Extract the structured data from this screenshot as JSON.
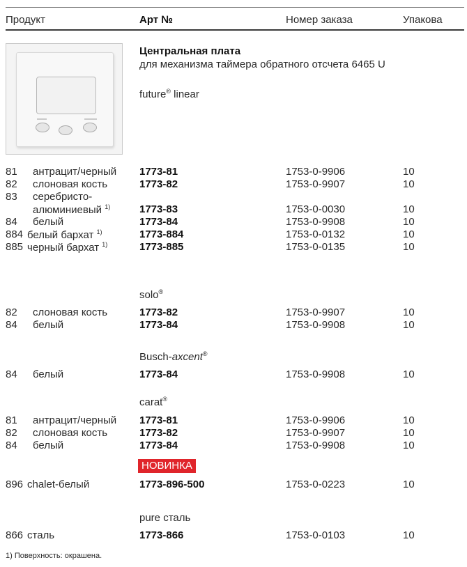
{
  "header": {
    "col_product": "Продукт",
    "col_art": "Арт №",
    "col_order": "Номер заказа",
    "col_pack": "Упакова"
  },
  "product": {
    "title": "Центральная плата",
    "subtitle": "для механизма таймера обратного отсчета 6465 U"
  },
  "sections": [
    {
      "series_name": "future",
      "series_reg": "®",
      "series_suffix": " linear",
      "rows": [
        {
          "code": "81",
          "name": "антрацит/черный",
          "art": "1773-81",
          "order": "1753-0-9906",
          "pack": "10"
        },
        {
          "code": "82",
          "name": "слоновая кость",
          "art": "1773-82",
          "order": "1753-0-9907",
          "pack": "10"
        },
        {
          "code": "83",
          "name": "серебристо-",
          "name2": "алюминиевый",
          "note": "1)",
          "art": "1773-83",
          "order": "1753-0-0030",
          "pack": "10"
        },
        {
          "code": "84",
          "name": "белый",
          "art": "1773-84",
          "order": "1753-0-9908",
          "pack": "10"
        },
        {
          "code": "884",
          "name": "белый бархат",
          "note": "1)",
          "art": "1773-884",
          "order": "1753-0-0132",
          "pack": "10"
        },
        {
          "code": "885",
          "name": "черный бархат",
          "note": "1)",
          "art": "1773-885",
          "order": "1753-0-0135",
          "pack": "10"
        }
      ]
    },
    {
      "series_name": "solo",
      "series_reg": "®",
      "rows": [
        {
          "code": "82",
          "name": "слоновая кость",
          "art": "1773-82",
          "order": "1753-0-9907",
          "pack": "10"
        },
        {
          "code": "84",
          "name": "белый",
          "art": "1773-84",
          "order": "1753-0-9908",
          "pack": "10"
        }
      ]
    },
    {
      "series_name": "Busch-",
      "series_italic": "axcent",
      "series_reg": "®",
      "rows": [
        {
          "code": "84",
          "name": "белый",
          "art": "1773-84",
          "order": "1753-0-9908",
          "pack": "10"
        }
      ]
    },
    {
      "series_name": "carat",
      "series_reg": "®",
      "rows": [
        {
          "code": "81",
          "name": "антрацит/черный",
          "art": "1773-81",
          "order": "1753-0-9906",
          "pack": "10"
        },
        {
          "code": "82",
          "name": "слоновая кость",
          "art": "1773-82",
          "order": "1753-0-9907",
          "pack": "10"
        },
        {
          "code": "84",
          "name": "белый",
          "art": "1773-84",
          "order": "1753-0-9908",
          "pack": "10"
        },
        {
          "code": "896",
          "name": "chalet-белый",
          "art": "1773-896-500",
          "order": "1753-0-0223",
          "pack": "10"
        }
      ]
    },
    {
      "series_name": "pure сталь",
      "rows": [
        {
          "code": "866",
          "name": "сталь",
          "art": "1773-866",
          "order": "1753-0-0103",
          "pack": "10"
        }
      ]
    }
  ],
  "badge_new": "НОВИНКА",
  "footnote": "1)  Поверхность: окрашена.",
  "colors": {
    "badge": "#e0252b",
    "text": "#1e1e1e"
  }
}
